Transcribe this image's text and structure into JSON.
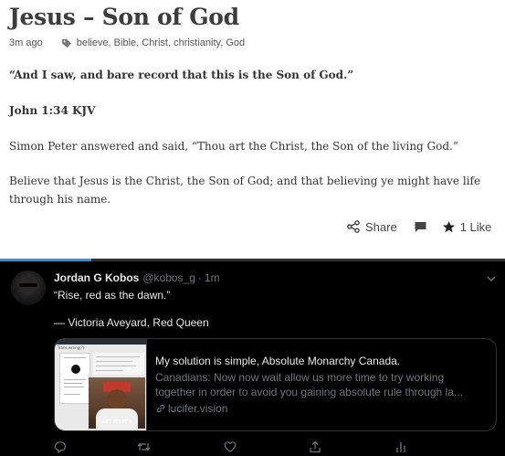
{
  "post": {
    "title": "Jesus – Son of God",
    "time": "3m ago",
    "tags": "believe, Bible, Christ, christianity, God",
    "quote": "“And I saw, and bare record that this is the Son of God.”",
    "reference": "John 1:34 KJV",
    "para1": "Simon Peter answered and said, “Thou art the Christ, the Son of the living God.”",
    "para2_line1": "Believe that Jesus is the Christ, the Son of God; and that believing ye might have life",
    "para2_line2": "through his name.",
    "actions": {
      "share_label": "Share",
      "like_label": "1 Like"
    },
    "icons": [
      "tag-icon",
      "share-icon",
      "reply-icon",
      "star-icon"
    ]
  },
  "tweet": {
    "progress_fraction": 0.18,
    "author": "Jordan G Kobos",
    "handle": "@kobos_g",
    "separator": "·",
    "time": "1m",
    "line1": "“Rise, red as the dawn.”",
    "line2": "— Victoria Aveyard, Red Queen",
    "card": {
      "thumb_header": "Trans wrong(?)",
      "thumb_caption": "GET IT? IT'S",
      "title": "My solution is simple, Absolute Monarchy Canada.",
      "desc_line1": "Canadians: Now now wait allow us more time to try working",
      "desc_line2": "together in order to avoid you gaining absolute rule through la...",
      "link": "lucifer.vision"
    },
    "icons": [
      "reply-icon",
      "retweet-icon",
      "like-icon",
      "share-icon",
      "analytics-icon"
    ],
    "colors": {
      "background": "#000000",
      "accent": "#1d9bf0",
      "muted": "#71767b",
      "text": "#e7e9ea"
    }
  }
}
